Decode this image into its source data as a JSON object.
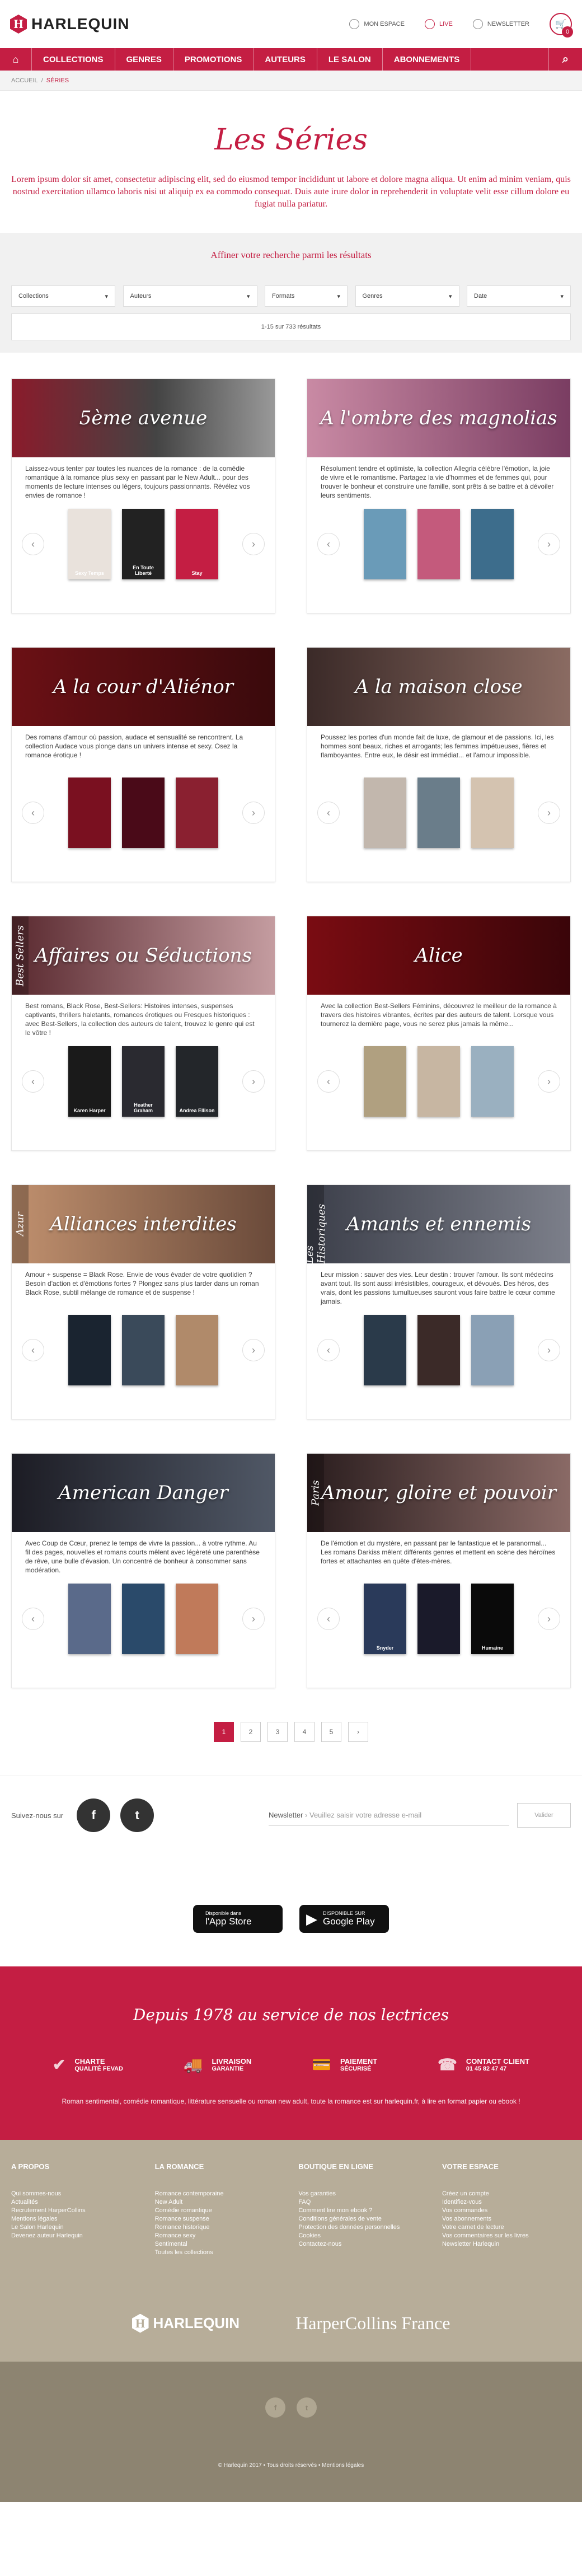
{
  "header": {
    "logo": "HARLEQUIN",
    "logo_letter": "H",
    "links": [
      {
        "label": "Mon espace"
      },
      {
        "label": "Live"
      },
      {
        "label": "Newsletter"
      }
    ],
    "cart_count": "0"
  },
  "nav": {
    "items": [
      "Collections",
      "Genres",
      "Promotions",
      "Auteurs",
      "Le salon",
      "Abonnements"
    ]
  },
  "breadcrumb": {
    "home": "Accueil",
    "sep": "/",
    "current": "Séries"
  },
  "hero": {
    "title": "Les Séries",
    "text": "Lorem ipsum dolor sit amet, consectetur adipiscing elit, sed do eiusmod tempor incididunt ut labore et dolore magna aliqua. Ut enim ad minim veniam, quis nostrud exercitation ullamco laboris nisi ut aliquip ex ea commodo consequat. Duis aute irure dolor in reprehenderit in voluptate velit esse cillum dolore eu fugiat nulla pariatur."
  },
  "filters": {
    "title": "Affiner votre recherche parmi les résultats",
    "selects": [
      "Collections",
      "Auteurs",
      "Formats",
      "Genres",
      "Date"
    ],
    "count": "1-15 sur 733 résultats"
  },
  "series": [
    {
      "title": "5ème avenue",
      "side": "",
      "desc": "Laissez-vous tenter par toutes les nuances de la romance : de la comédie romantique à la romance plus sexy en passant par le New Adult... pour des moments de lecture intenses ou légers, toujours passionnants. Révélez vos envies de romance !",
      "books": [
        "Sexy Temps",
        "En Toute Liberté",
        "Stay"
      ]
    },
    {
      "title": "A l'ombre des magnolias",
      "side": "",
      "desc": "Résolument tendre et optimiste, la collection Allegria célèbre l'émotion, la joie de vivre et le romantisme. Partagez la vie d'hommes et de femmes qui, pour trouver le bonheur et construire une famille, sont prêts à se battre et à dévoiler leurs sentiments.",
      "books": [
        "",
        "",
        ""
      ]
    },
    {
      "title": "A la cour d'Aliénor",
      "side": "",
      "desc": "Des romans d'amour où passion, audace et sensualité se rencontrent. La collection Audace vous plonge dans un univers intense et sexy. Osez la romance érotique !",
      "books": [
        "",
        "",
        ""
      ]
    },
    {
      "title": "A la maison close",
      "side": "",
      "desc": "Poussez les portes d'un monde fait de luxe, de glamour et de passions. Ici, les hommes sont beaux, riches et arrogants; les femmes impétueuses, fières et flamboyantes. Entre eux, le désir est immédiat... et l'amour impossible.",
      "books": [
        "",
        "",
        ""
      ]
    },
    {
      "title": "Affaires ou Séductions",
      "side": "Best Sellers",
      "desc": "Best romans, Black Rose, Best-Sellers: Histoires intenses, suspenses captivants, thrillers haletants, romances érotiques ou Fresques historiques : avec Best-Sellers, la collection des auteurs de talent, trouvez le genre qui est le vôtre !",
      "books": [
        "Karen Harper",
        "Heather Graham",
        "Andrea Ellison"
      ]
    },
    {
      "title": "Alice",
      "side": "",
      "desc": "Avec la collection Best-Sellers Féminins, découvrez le meilleur de la romance à travers des histoires vibrantes, écrites par des auteurs de talent. Lorsque vous tournerez la dernière page, vous ne serez plus jamais la même...",
      "books": [
        "",
        "",
        ""
      ]
    },
    {
      "title": "Alliances interdites",
      "side": "Azur",
      "desc": "Amour + suspense = Black Rose. Envie de vous évader de votre quotidien ? Besoin d'action et d'émotions fortes ? Plongez sans plus tarder dans un roman Black Rose, subtil mélange de romance et de suspense !",
      "books": [
        "",
        "",
        ""
      ]
    },
    {
      "title": "Amants et ennemis",
      "side": "Les Historiques",
      "desc": "Leur mission : sauver des vies. Leur destin : trouver l'amour. Ils sont médecins avant tout. Ils sont aussi irrésistibles, courageux, et dévoués. Des héros, des vrais, dont les passions tumultueuses sauront vous faire battre le cœur comme jamais.",
      "books": [
        "",
        "",
        ""
      ]
    },
    {
      "title": "American Danger",
      "side": "",
      "desc": "Avec Coup de Cœur, prenez le temps de vivre la passion... à votre rythme. Au fil des pages, nouvelles et romans courts mêlent avec légèreté une parenthèse de rêve, une bulle d'évasion. Un concentré de bonheur à consommer sans modération.",
      "books": [
        "",
        "",
        ""
      ]
    },
    {
      "title": "Amour, gloire et pouvoir",
      "side": "Paris",
      "desc": "De l'émotion et du mystère, en passant par le fantastique et le paranormal... Les romans Darkiss mêlent différents genres et mettent en scène des héroïnes fortes et attachantes en quête d'êtes-mères.",
      "books": [
        "Snyder",
        "",
        "Humaine"
      ]
    }
  ],
  "pager": [
    "1",
    "2",
    "3",
    "4",
    "5",
    "›"
  ],
  "social": {
    "label": "Suivez-nous sur",
    "fb": "f",
    "tw": "t"
  },
  "newsletter": {
    "label": "Newsletter",
    "placeholder": "Veuillez saisir votre adresse e-mail",
    "button": "Valider"
  },
  "apps": [
    {
      "small": "Disponible dans",
      "big": "l'App Store",
      "glyph": ""
    },
    {
      "small": "DISPONIBLE SUR",
      "big": "Google Play",
      "glyph": "▶"
    }
  ],
  "promo": {
    "title": "Depuis 1978 au service de nos lectrices",
    "features": [
      {
        "a": "Charte",
        "b": "Qualité FEVAD",
        "icon": "✔"
      },
      {
        "a": "Livraison",
        "b": "Garantie",
        "icon": "🚚"
      },
      {
        "a": "Paiement",
        "b": "Sécurisé",
        "icon": "💳"
      },
      {
        "a": "Contact client",
        "b": "01 45 82 47 47",
        "icon": "☎"
      }
    ],
    "text": "Roman sentimental, comédie romantique, littérature sensuelle ou roman new adult, toute la romance est sur harlequin.fr, à lire en format papier ou ebook !"
  },
  "footer": {
    "cols": [
      {
        "title": "A propos",
        "links": [
          "Qui sommes-nous",
          "Actualités",
          "Recrutement HarperCollins",
          "Mentions légales",
          "Le Salon Harlequin",
          "Devenez auteur Harlequin"
        ]
      },
      {
        "title": "La romance",
        "links": [
          "Romance contemporaine",
          "New Adult",
          "Comédie romantique",
          "Romance suspense",
          "Romance historique",
          "Romance sexy",
          "Sentimental",
          "Toutes les collections"
        ]
      },
      {
        "title": "Boutique en ligne",
        "links": [
          "Vos garanties",
          "FAQ",
          "Comment lire mon ebook ?",
          "Conditions générales de vente",
          "Protection des données personnelles",
          "Cookies",
          "Contactez-nous"
        ]
      },
      {
        "title": "Votre espace",
        "links": [
          "Créez un compte",
          "Identifiez-vous",
          "Vos commandes",
          "Vos abonnements",
          "Votre carnet de lecture",
          "Vos commentaires sur les livres",
          "Newsletter Harlequin"
        ]
      }
    ],
    "brand2": "HarperCollins France",
    "copyright": "© Harlequin 2017 • Tous droits réservés • Mentions légales",
    "social": [
      "f",
      "t"
    ]
  }
}
